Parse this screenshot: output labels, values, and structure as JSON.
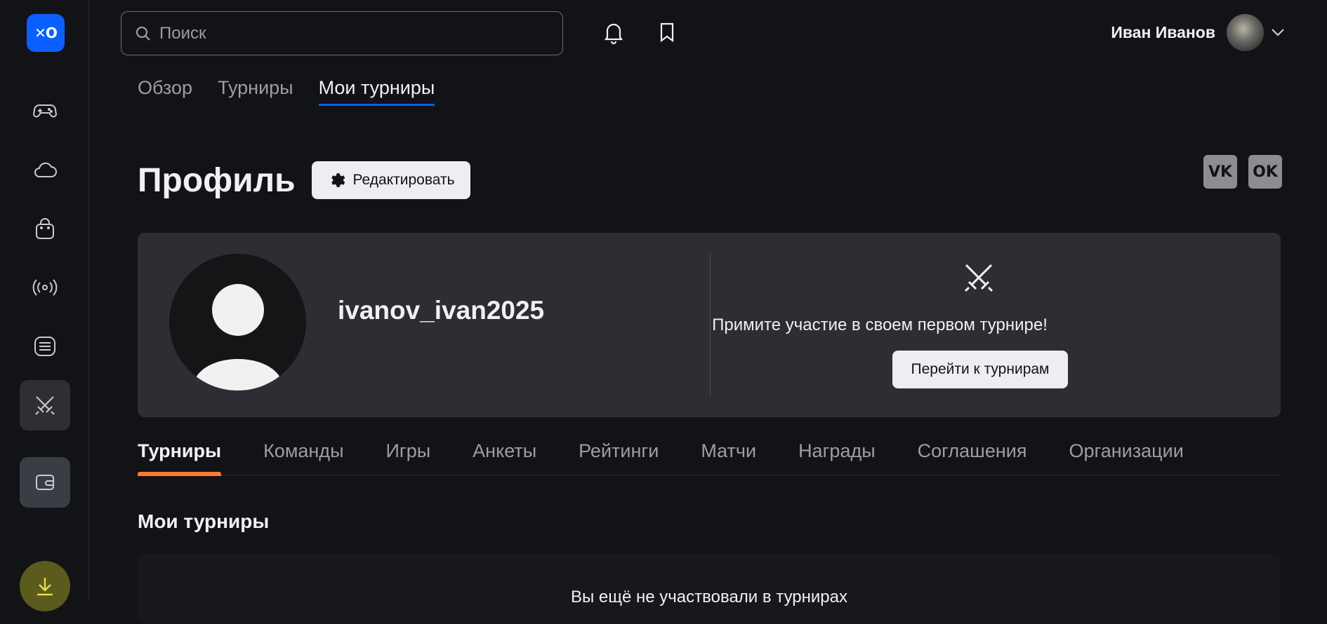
{
  "logo": {
    "text": "✕O"
  },
  "sidebar": {
    "items": [
      {
        "name": "games",
        "icon": "gamepad-icon"
      },
      {
        "name": "cloud",
        "icon": "cloud-icon"
      },
      {
        "name": "store",
        "icon": "shopping-bag-icon"
      },
      {
        "name": "streams",
        "icon": "broadcast-icon"
      },
      {
        "name": "news",
        "icon": "news-icon"
      },
      {
        "name": "tournaments",
        "icon": "swords-icon",
        "active": true
      },
      {
        "name": "wallet",
        "icon": "wallet-icon"
      },
      {
        "name": "download",
        "icon": "download-icon"
      }
    ]
  },
  "header": {
    "search_placeholder": "Поиск",
    "user_name": "Иван Иванов"
  },
  "top_tabs": [
    {
      "label": "Обзор",
      "active": false
    },
    {
      "label": "Турниры",
      "active": false
    },
    {
      "label": "Мои турниры",
      "active": true
    }
  ],
  "profile": {
    "title": "Профиль",
    "edit_label": "Редактировать",
    "social": {
      "vk": "VK",
      "ok": "OK"
    },
    "username": "ivanov_ivan2025",
    "cta_text": "Примите участие в своем первом турнире!",
    "cta_button": "Перейти к турнирам"
  },
  "section_tabs": [
    {
      "label": "Турниры",
      "active": true
    },
    {
      "label": "Команды",
      "active": false
    },
    {
      "label": "Игры",
      "active": false
    },
    {
      "label": "Анкеты",
      "active": false
    },
    {
      "label": "Рейтинги",
      "active": false
    },
    {
      "label": "Матчи",
      "active": false
    },
    {
      "label": "Награды",
      "active": false
    },
    {
      "label": "Соглашения",
      "active": false
    },
    {
      "label": "Организации",
      "active": false
    }
  ],
  "my_tournaments": {
    "title": "Мои турниры",
    "empty_text": "Вы ещё не участвовали в турнирах"
  },
  "colors": {
    "accent_blue": "#0b5fff",
    "accent_orange": "#ff7a2e",
    "background": "#121316",
    "card": "#2d2d33"
  }
}
